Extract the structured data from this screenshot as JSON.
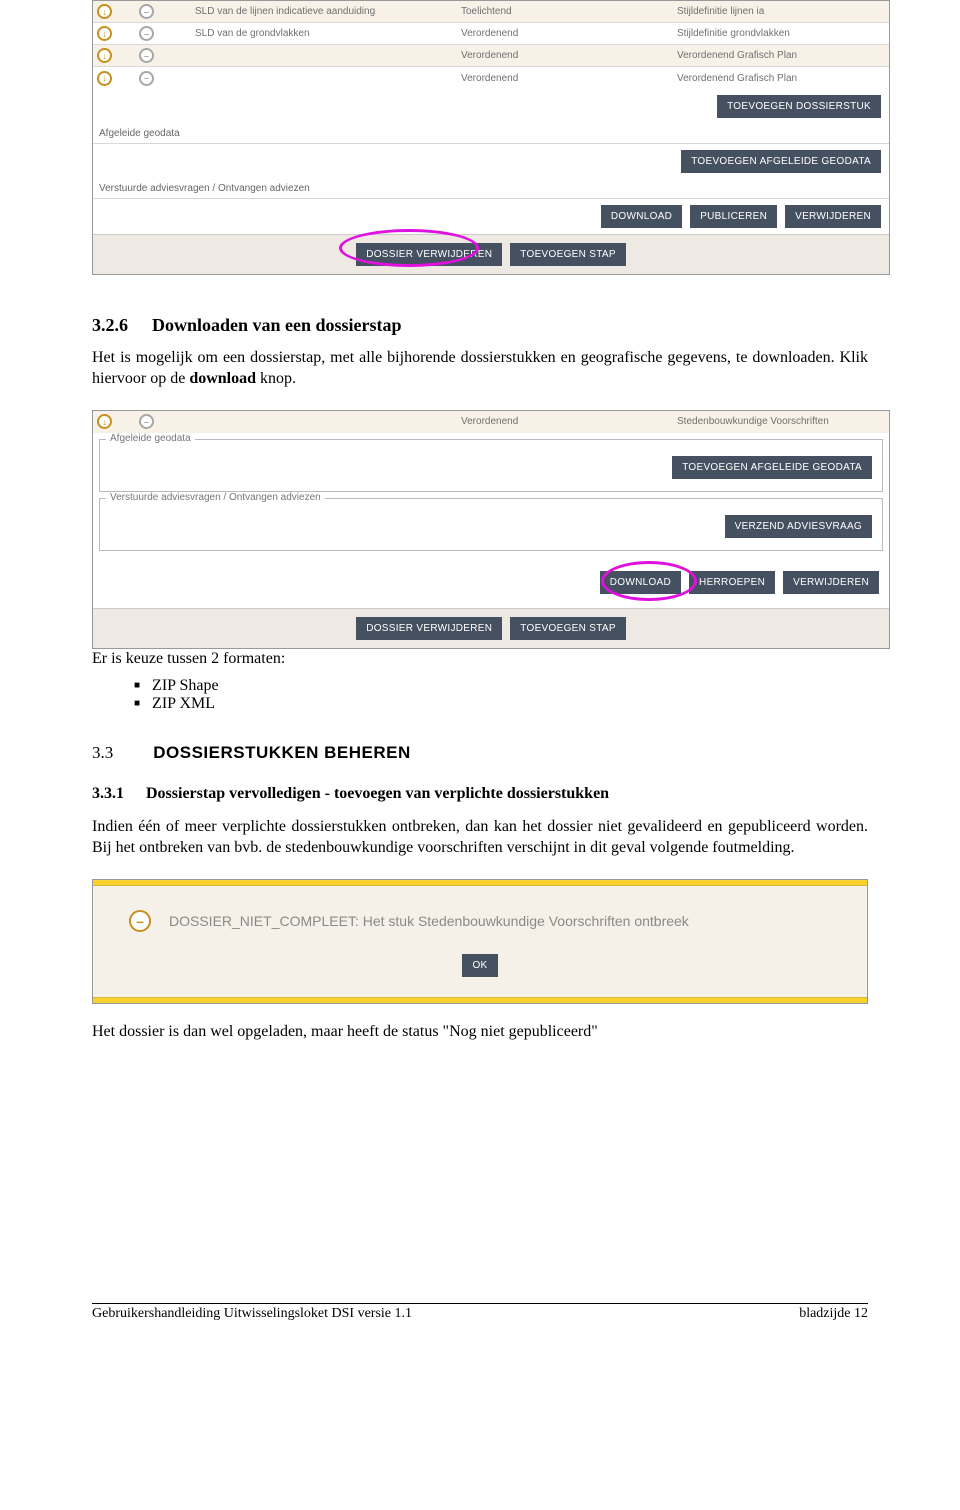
{
  "shot1": {
    "rows": [
      {
        "name": "SLD van de lijnen indicatieve aanduiding",
        "mid": "Toelichtend",
        "right": "Stijldefinitie lijnen ia"
      },
      {
        "name": "SLD van de grondvlakken",
        "mid": "Verordenend",
        "right": "Stijldefinitie grondvlakken"
      },
      {
        "name": "",
        "mid": "Verordenend",
        "right": "Verordenend Grafisch Plan"
      },
      {
        "name": "",
        "mid": "Verordenend",
        "right": "Verordenend Grafisch Plan"
      }
    ],
    "btn_toevoegen_dossierstuk": "TOEVOEGEN DOSSIERSTUK",
    "section_afgeleide": "Afgeleide geodata",
    "btn_toevoegen_geodata": "TOEVOEGEN AFGELEIDE GEODATA",
    "section_advies": "Verstuurde adviesvragen / Ontvangen adviezen",
    "btn_download": "DOWNLOAD",
    "btn_publiceren": "PUBLICEREN",
    "btn_verwijderen": "VERWIJDEREN",
    "btn_dossier_verwijderen": "DOSSIER VERWIJDEREN",
    "btn_toevoegen_stap": "TOEVOEGEN STAP"
  },
  "sec326": {
    "num": "3.2.6",
    "title": "Downloaden van een dossierstap",
    "para": "Het is mogelijk om een dossierstap, met alle bijhorende dossierstukken en geografische gegevens, te downloaden.  Klik hiervoor op de ",
    "bold": "download",
    "para_end": " knop."
  },
  "shot2": {
    "row": {
      "mid": "Verordenend",
      "right": "Stedenbouwkundige Voorschriften"
    },
    "fs_afgeleide": "Afgeleide geodata",
    "btn_geodata": "TOEVOEGEN AFGELEIDE GEODATA",
    "fs_advies": "Verstuurde adviesvragen / Ontvangen adviezen",
    "btn_adviesvraag": "VERZEND ADVIESVRAAG",
    "btn_download": "DOWNLOAD",
    "btn_herroepen": "HERROEPEN",
    "btn_verwijderen": "VERWIJDEREN",
    "btn_dossier_verwijderen": "DOSSIER VERWIJDEREN",
    "btn_toevoegen_stap": "TOEVOEGEN STAP"
  },
  "formats": {
    "intro": "Er is keuze tussen 2 formaten:",
    "items": [
      "ZIP Shape",
      "ZIP XML"
    ]
  },
  "sec33": {
    "num": "3.3",
    "title": "DOSSIERSTUKKEN BEHEREN"
  },
  "sec331": {
    "num": "3.3.1",
    "title": "Dossierstap vervolledigen - toevoegen van verplichte dossierstukken",
    "para": "Indien één of meer verplichte dossierstukken ontbreken, dan kan het dossier niet gevalideerd en gepubliceerd worden.  Bij het ontbreken van bvb. de stedenbouwkundige voorschriften verschijnt in dit geval volgende foutmelding."
  },
  "dialog": {
    "msg": "DOSSIER_NIET_COMPLEET: Het stuk Stedenbouwkundige Voorschriften ontbreek",
    "ok": "OK"
  },
  "closing": "Het dossier is dan wel opgeladen, maar heeft de status \"Nog niet gepubliceerd\"",
  "footer": {
    "left": "Gebruikershandleiding Uitwisselingsloket DSI versie 1.1",
    "right": "bladzijde 12"
  }
}
